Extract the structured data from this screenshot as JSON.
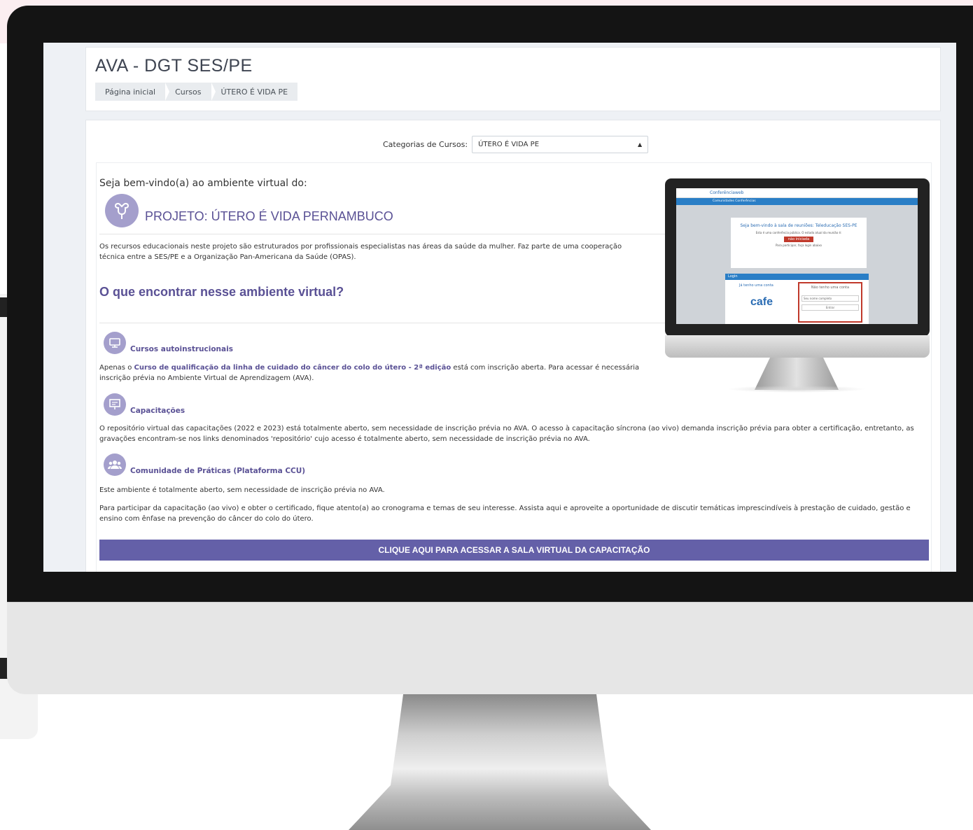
{
  "site_title": "AVA - DGT SES/PE",
  "breadcrumb": [
    "Página inicial",
    "Cursos",
    "ÚTERO É VIDA PE"
  ],
  "category_selector": {
    "label": "Categorias de Cursos:",
    "value": "ÚTERO É VIDA PE"
  },
  "welcome": "Seja bem-vindo(a) ao ambiente virtual do:",
  "project_title": "PROJETO: ÚTERO É VIDA PERNAMBUCO",
  "intro": "Os recursos educacionais neste projeto são estruturados por profissionais especialistas nas áreas da saúde da mulher. Faz parte de uma cooperação técnica entre a SES/PE e a Organização Pan-Americana da Saúde (OPAS).",
  "section_heading": "O que encontrar nesse ambiente virtual?",
  "sections": [
    {
      "title": "Cursos autoinstrucionais",
      "text_before": "Apenas o ",
      "link": "Curso de qualificação da linha de cuidado do câncer do colo do útero - 2ª edição",
      "text_after": " está com inscrição aberta. Para acessar é necessária inscrição prévia no Ambiente Virtual de Aprendizagem (AVA)."
    },
    {
      "title": "Capacitações",
      "text": "O repositório virtual das capacitações (2022 e 2023) está totalmente aberto, sem necessidade de inscrição prévia no AVA. O acesso à capacitação síncrona (ao vivo) demanda inscrição prévia para obter a certificação, entretanto, as gravações encontram-se nos links denominados 'repositório' cujo acesso é totalmente aberto, sem necessidade de inscrição prévia no  AVA."
    },
    {
      "title": "Comunidade de Práticas (Plataforma CCU)",
      "text": "Este ambiente é totalmente aberto, sem necessidade de inscrição prévia no AVA.",
      "text2": "Para participar da capacitação (ao vivo) e obter o certificado, fique atento(a) ao cronograma e temas de seu interesse. Assista aqui e aproveite a oportunidade de discutir temáticas imprescindíveis à prestação de cuidado, gestão e ensino com ênfase na prevenção do câncer do colo do útero."
    }
  ],
  "cta_button": "CLIQUE AQUI PARA ACESSAR A SALA VIRTUAL DA CAPACITAÇÃO",
  "mini_screen": {
    "brand": "Conferênciaweb",
    "nav": "Comunidades   Conferências",
    "welcome": "Seja bem-vindo à sala de reuniões: Teleducação SES-PE",
    "status_line": "Esta é uma conferência pública. O estado atual da reunião é:",
    "status": "não iniciada",
    "hint": "Para participar, faça login abaixo",
    "login_label": "Login",
    "have_account": "Já tenho uma conta",
    "cafe": "cafe",
    "no_account": "Não tenho uma conta",
    "name_placeholder": "Seu nome completo",
    "enter": "Entrar"
  },
  "colors": {
    "accent": "#5a5195",
    "button": "#6460a8",
    "icon_circle": "#a49fcc"
  }
}
